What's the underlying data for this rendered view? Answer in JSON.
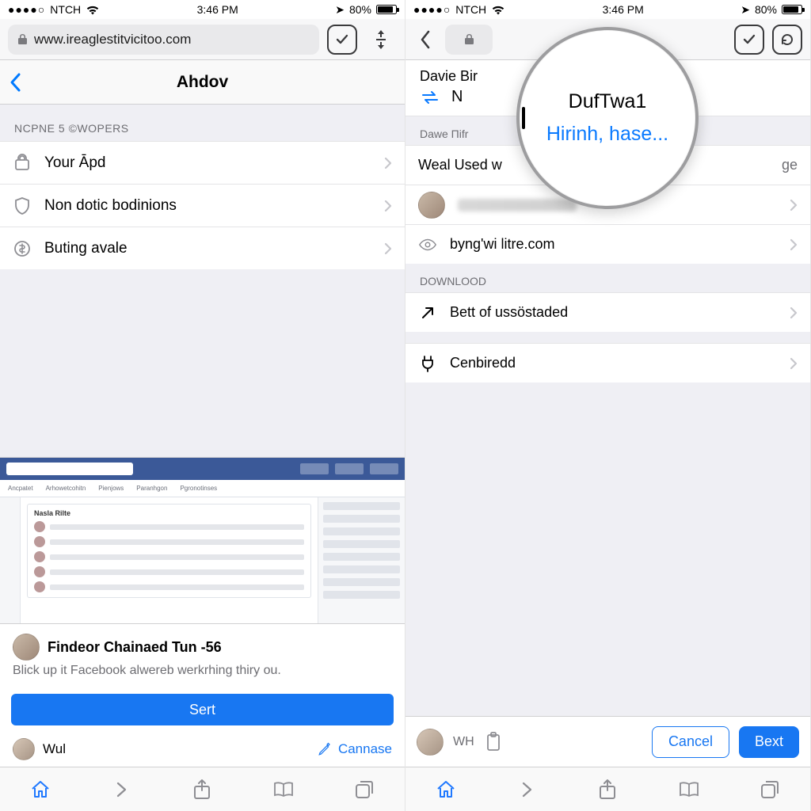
{
  "statusbar": {
    "carrier_dots": "●●●●○",
    "carrier": "NTCH",
    "time": "3:46 PM",
    "battery_pct": "80%",
    "location_glyph": "➤"
  },
  "left": {
    "url": "www.ireaglestitvicitoo.com",
    "nav_title": "Ahdov",
    "section1": "NCPNE 5 ©WOPERS",
    "rows": [
      "Your Āpd",
      "Non dotic bodinions",
      "Buting avale"
    ],
    "preview": {
      "fb_box_hd": "Nasla Rilte",
      "title": "Findeor Chainaed Tun -56",
      "subtitle": "Blick up it Facebook alwereb werkrhing thiry ou.",
      "primary_btn": "Sert",
      "mini_left": "Wul",
      "mini_right": "Cannase"
    }
  },
  "right": {
    "header_crumb": "Davie Bir",
    "header_sugg_row1": "N",
    "section2a": "Dawe Пifr",
    "weal_row": "Weal Used w",
    "weal_row_right": "ge",
    "row_site": "byng'wi litre.com",
    "section_download": "DOWNLOOD",
    "row_bett": "Bett of ussöstaded",
    "row_cen": "Cenbiredd",
    "bottom_wh": "WH",
    "btn_cancel": "Cancel",
    "btn_next": "Bext"
  },
  "magnifier": {
    "line1": "DufTwa1",
    "line2": "Hirinh, hase..."
  }
}
